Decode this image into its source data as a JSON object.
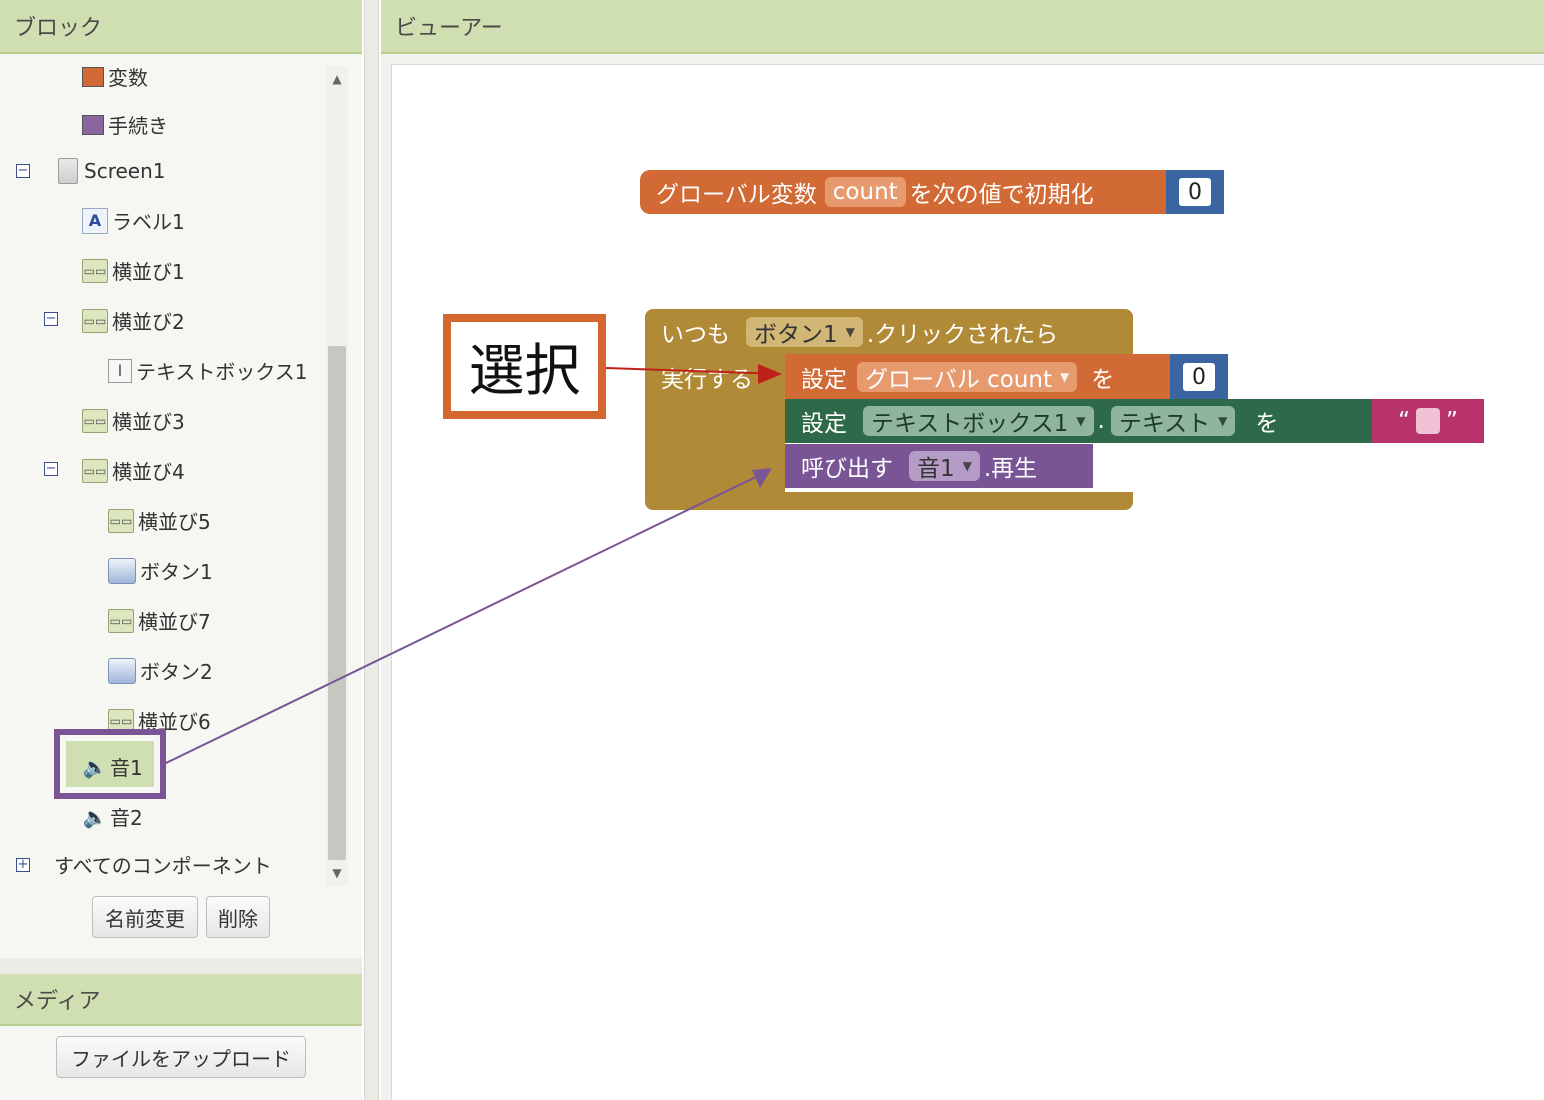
{
  "panels": {
    "blocks_title": "ブロック",
    "viewer_title": "ビューアー",
    "media_title": "メディア"
  },
  "tree": {
    "variables": "変数",
    "procedures": "手続き",
    "screen": "Screen1",
    "label1": "ラベル1",
    "hbox1": "横並び1",
    "hbox2": "横並び2",
    "textbox1": "テキストボックス1",
    "hbox3": "横並び3",
    "hbox4": "横並び4",
    "hbox5": "横並び5",
    "button1": "ボタン1",
    "hbox7": "横並び7",
    "button2": "ボタン2",
    "hbox6": "横並び6",
    "sound1": "音1",
    "sound2": "音2",
    "all_components": "すべてのコンポーネント"
  },
  "buttons": {
    "rename": "名前変更",
    "delete": "削除",
    "upload": "ファイルをアップロード"
  },
  "blocks": {
    "global_init": {
      "prefix": "グローバル変数",
      "name": "count",
      "suffix": "を次の値で初期化",
      "value": "0"
    },
    "event": {
      "when": "いつも",
      "component": "ボタン1",
      "event": ".クリックされたら",
      "do": "実行する"
    },
    "set_global": {
      "set": "設定",
      "var": "グローバル count",
      "to": "を",
      "value": "0"
    },
    "set_text": {
      "set": "設定",
      "component": "テキストボックス1",
      "dot": ".",
      "prop": "テキスト",
      "to": "を",
      "open_quote": "“",
      "close_quote": "”"
    },
    "call": {
      "call": "呼び出す",
      "component": "音1",
      "method": ".再生"
    }
  },
  "annotation": {
    "label": "選択"
  },
  "colors": {
    "header": "#cfdfb1",
    "variable_block": "#d26a35",
    "event_block": "#b08a36",
    "set_prop_block": "#2e6a4a",
    "call_block": "#7a5596",
    "text_block": "#b8336a",
    "math_block": "#3a65a0",
    "annotation_box": "#d4662f",
    "highlight_box": "#7a5596"
  },
  "icons": {
    "variables": "orange-swatch-icon",
    "procedures": "purple-swatch-icon",
    "screen": "screen-icon",
    "label": "label-icon",
    "hbox": "horizontal-arrangement-icon",
    "textbox": "textbox-icon",
    "button": "button-icon",
    "sound": "sound-icon"
  }
}
